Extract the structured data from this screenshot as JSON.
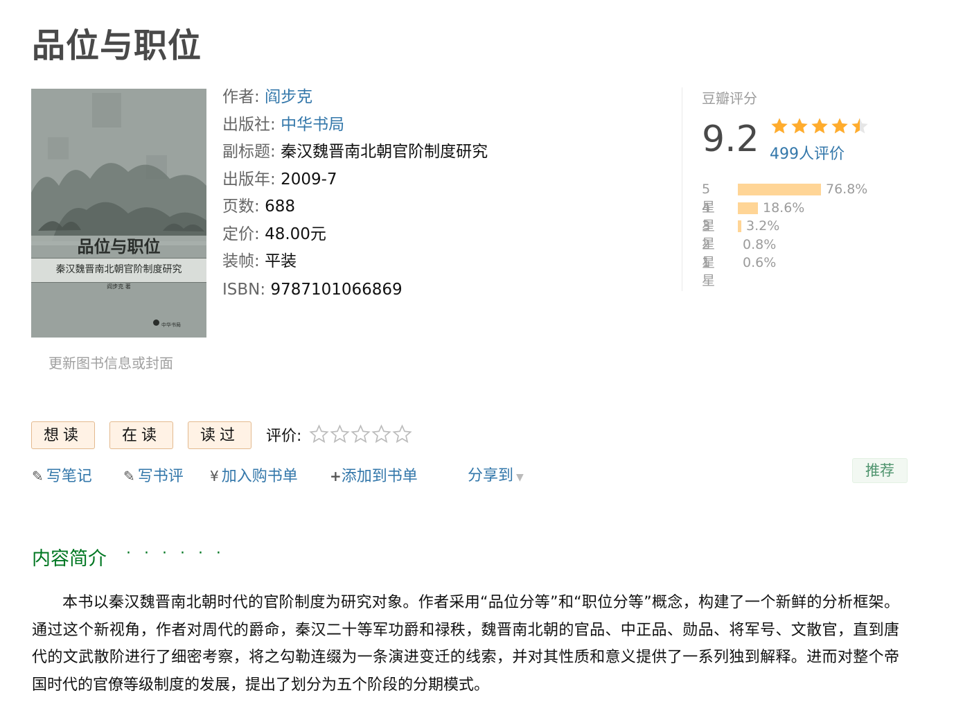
{
  "book": {
    "title": "品位与职位",
    "cover": {
      "title": "品位与职位",
      "subtitle": "秦汉魏晋南北朝官阶制度研究",
      "author": "阎步克 著",
      "publisher": "中华书局"
    },
    "update_link": "更新图书信息或封面"
  },
  "info": {
    "author_label": "作者:",
    "author": "阎步克",
    "publisher_label": "出版社:",
    "publisher": "中华书局",
    "subtitle_label": "副标题:",
    "subtitle": "秦汉魏晋南北朝官阶制度研究",
    "year_label": "出版年:",
    "year": "2009-7",
    "pages_label": "页数:",
    "pages": "688",
    "price_label": "定价:",
    "price": "48.00元",
    "binding_label": "装帧:",
    "binding": "平装",
    "isbn_label": "ISBN:",
    "isbn": "9787101066869"
  },
  "rating": {
    "caption": "豆瓣评分",
    "score": "9.2",
    "stars_out_of_5": 4.5,
    "count": "499人评价",
    "distribution": [
      {
        "label": "5星",
        "percent": "76.8%",
        "value": 76.8
      },
      {
        "label": "4星",
        "percent": "18.6%",
        "value": 18.6
      },
      {
        "label": "3星",
        "percent": "3.2%",
        "value": 3.2
      },
      {
        "label": "2星",
        "percent": "0.8%",
        "value": 0.8
      },
      {
        "label": "1星",
        "percent": "0.6%",
        "value": 0.6
      }
    ]
  },
  "actions": {
    "want": "想读",
    "reading": "在读",
    "read": "读过",
    "rate_label": "评价:",
    "user_rating": 0,
    "note": "写笔记",
    "review": "写书评",
    "cart": "加入购书单",
    "add_list": "添加到书单",
    "share": "分享到",
    "recommend": "推荐"
  },
  "intro": {
    "heading": "内容简介",
    "dots": "· · · · · ·",
    "text": "本书以秦汉魏晋南北朝时代的官阶制度为研究对象。作者采用“品位分等”和“职位分等”概念，构建了一个新鲜的分析框架。通过这个新视角，作者对周代的爵命，秦汉二十等军功爵和禄秩，魏晋南北朝的官品、中正品、勋品、将军号、文散官，直到唐代的文武散阶进行了细密考察，将之勾勒连缀为一条演进变迁的线索，并对其性质和意义提供了一系列独到解释。进而对整个帝国时代的官僚等级制度的发展，提出了划分为五个阶段的分期模式。"
  },
  "colors": {
    "link": "#3377aa",
    "green": "#007722",
    "bar": "#ffd596",
    "star": "#ffac2d"
  }
}
